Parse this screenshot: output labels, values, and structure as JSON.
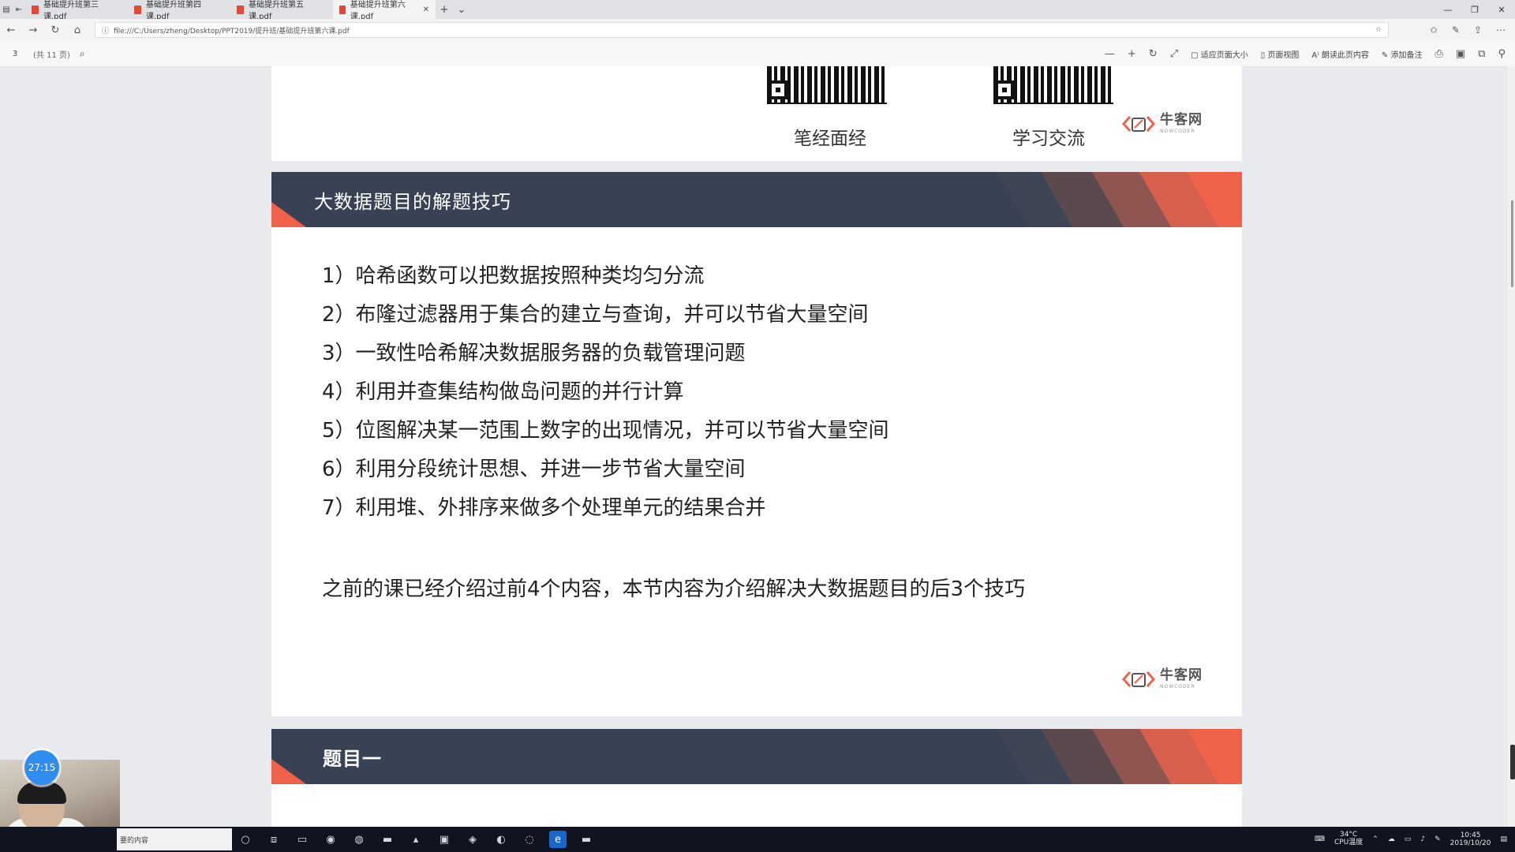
{
  "browser": {
    "tabs": [
      {
        "title": "基础提升班第三课.pdf",
        "active": false
      },
      {
        "title": "基础提升班第四课.pdf",
        "active": false
      },
      {
        "title": "基础提升班第五课.pdf",
        "active": false
      },
      {
        "title": "基础提升班第六课.pdf",
        "active": true
      }
    ],
    "url": "file:///C:/Users/zheng/Desktop/PPT2019/提升班/基础提升班第六课.pdf"
  },
  "pdf_toolbar": {
    "page_input": "3",
    "page_count": "(共 11 页)",
    "fit_page": "适应页面大小",
    "page_view": "页面视图",
    "read_aloud": "朗读此页内容",
    "add_notes": "添加备注"
  },
  "page_top": {
    "qr_left_label": "笔经面经",
    "qr_right_label": "学习交流",
    "logo_cn": "牛客网",
    "logo_en": "NOWCODER"
  },
  "slide": {
    "title": "大数据题目的解题技巧",
    "items": [
      "1）哈希函数可以把数据按照种类均匀分流",
      "2）布隆过滤器用于集合的建立与查询，并可以节省大量空间",
      "3）一致性哈希解决数据服务器的负载管理问题",
      "4）利用并查集结构做岛问题的并行计算",
      "5）位图解决某一范围上数字的出现情况，并可以节省大量空间",
      "6）利用分段统计思想、并进一步节省大量空间",
      "7）利用堆、外排序来做多个处理单元的结果合并"
    ],
    "note": "之前的课已经介绍过前4个内容，本节内容为介绍解决大数据题目的后3个技巧",
    "logo_cn": "牛客网",
    "logo_en": "NOWCODER"
  },
  "next_slide": {
    "title": "题目一"
  },
  "overlay": {
    "timer": "27:15"
  },
  "taskbar": {
    "search_placeholder": "要的内容",
    "cpu_temp": "34°C",
    "cpu_label": "CPU温度",
    "time": "10:45",
    "date": "2019/10/20"
  },
  "colors": {
    "header_bg": "#394254",
    "accent_orange": "#f0614a",
    "page_bg": "#e9eaee"
  }
}
